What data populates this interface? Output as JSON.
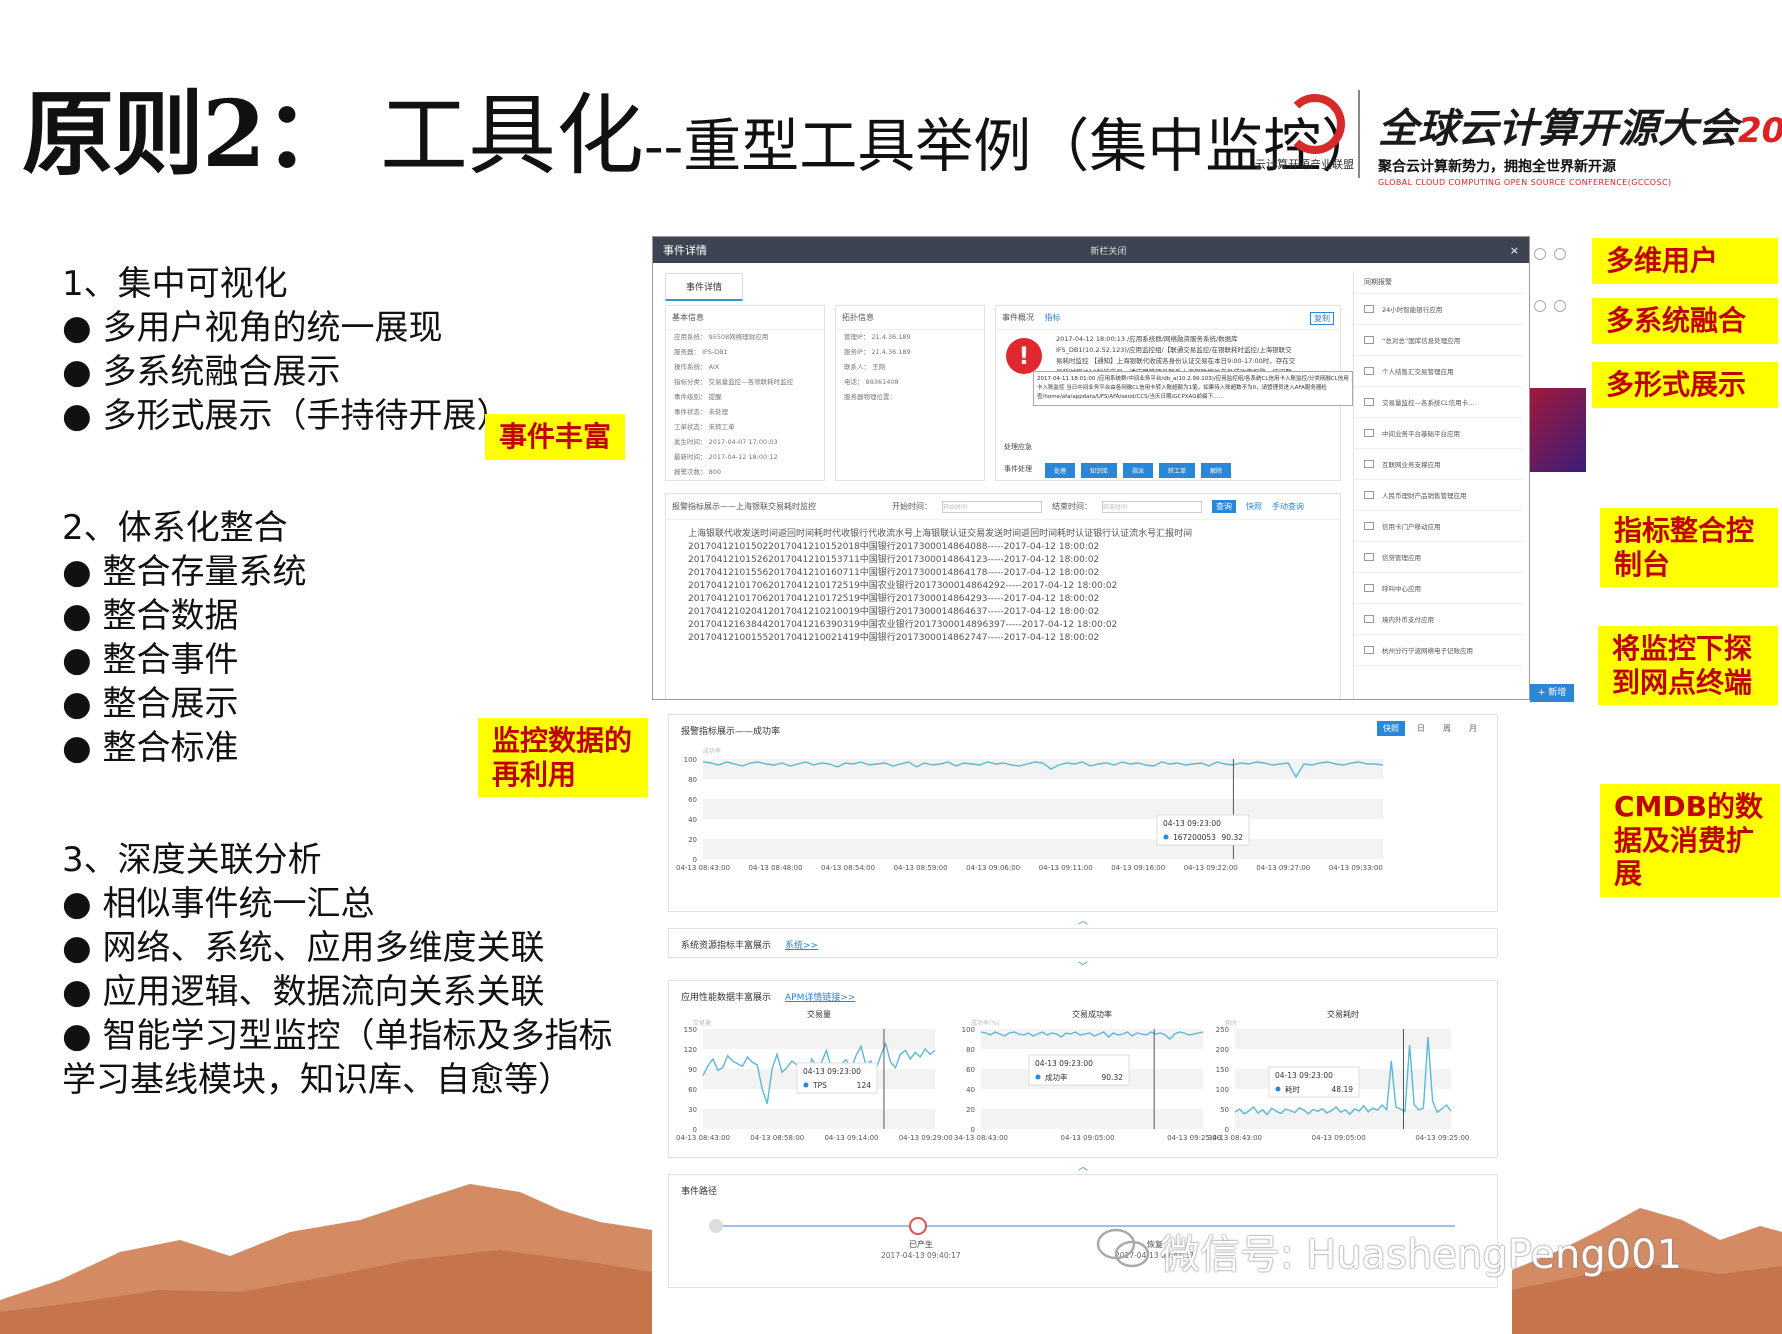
{
  "slide": {
    "title_main": "原则2：",
    "title_topic": "工具化",
    "title_sub": "--重型工具举例（集中监控）",
    "logo_text": "云计算开源产业联盟",
    "conference_name": "全球云计算开源大会",
    "conference_year": "2017",
    "conference_slogan": "聚合云计算新势力，拥抱全世界新开源",
    "conference_en": "GLOBAL CLOUD COMPUTING OPEN SOURCE CONFERENCE(GCCOSC)",
    "watermark": "微信号: HuashengPeng001"
  },
  "sections": [
    {
      "heading": "1、集中可视化",
      "items": [
        "● 多用户视角的统一展现",
        "● 多系统融合展示",
        "● 多形式展示（手持待开展）"
      ]
    },
    {
      "heading": "2、体系化整合",
      "items": [
        "● 整合存量系统",
        "● 整合数据",
        "● 整合事件",
        "● 整合展示",
        "● 整合标准"
      ]
    },
    {
      "heading": "3、深度关联分析",
      "items": [
        "● 相似事件统一汇总",
        "● 网络、系统、应用多维度关联",
        "● 应用逻辑、数据流向关系关联",
        "● 智能学习型监控（单指标及多指标",
        "学习基线模块，知识库、自愈等）"
      ]
    }
  ],
  "tags": {
    "events_rich": "事件丰富",
    "data_reuse": "监控数据的再利用",
    "multi_user": "多维用户",
    "multi_system": "多系统融合",
    "multi_form": "多形式展示",
    "indicator_console": "指标整合控制台",
    "drill_down": "将监控下探到网点终端",
    "cmdb": "CMDB的数据及消费扩展"
  },
  "event_window": {
    "title": "事件详情",
    "center": "新栏关闭",
    "close": "×",
    "tab": "事件详情",
    "basic_header": "基本信息",
    "topo_header": "拓扑信息",
    "summary_header": "事件概况",
    "summary_link": "指标",
    "copy_btn": "复制",
    "basic": [
      "应用系统：  95508网络理财应用",
      "服务器：   IFS-DB1",
      "操作系统：  AIX",
      "指标分类：  交易量监控—各领联耗时监控",
      "事件级别：  提醒",
      "事件状态：  未处理",
      "工单状态：  未转工单",
      "发生时间：  2017-04-07 17:00:03",
      "最新时间：  2017-04-12 18:00:12",
      "报警次数：  800"
    ],
    "topo": [
      "管理IP：     21.4.36.189",
      "服务IP：     21.4.36.189",
      "联系人：     王刚",
      "电话：       89361408",
      "服务器物理位置："
    ],
    "event_text": "2017-04-12 18:00:13 /应用系统群/网络融资服务系统/数据库IFS_DB1(10.2.52.123)/应用监控组/【联通交易监控/在银联耗时监控/上海银联交易耗时监控 【通知】上海银联代收成各身份认证交易在本日9:00-17:00时，存在交易耗时超过10秒的交易，请应用管理员联系上海银联相关交易成功率报警。该问题一般为银联问题，可提供本监控中的流水至上海银联查询。",
    "tooltip_text": "2017-04-11 18:01:00 /应用系统群/中间业务平台/db_a(10.2.99.103)/应用监控组/各系统CL信用卡入账监控/分类网融CL信用卡入账监控 当日中间业务平台由各网融CL信用卡转入账超额为1笔，如果待入账超数不为0，请管理员进入AFA服务器检查/home/afa/appdata/UFS/AFA/send/CCS/当天日期/GCPXAG前缀下……",
    "action_labels": [
      "处理应急",
      "事件处理"
    ],
    "buttons": [
      "处理",
      "知识库",
      "指派",
      "转工单",
      "解除"
    ],
    "table_title": "报警指标展示——上海银联交易耗时监控",
    "start_label": "开始时间：",
    "start_placeholder": "开始时间",
    "end_label": "结束时间：",
    "end_placeholder": "结束时间",
    "query_btn": "查询",
    "links": [
      "快照",
      "手动查询"
    ],
    "columns": [
      "上海银联代收发送时间",
      "返回时间",
      "耗时",
      "代收银行",
      "代收流水号",
      "上海银联认证交易发送时间",
      "返回时间",
      "耗时",
      "认证银行",
      "认证流水号",
      "汇报时间"
    ],
    "rows": [
      [
        "20170412101502",
        "20170412101520",
        "18",
        "中国银行",
        "2017300014864088",
        "-",
        "-",
        "-",
        "-",
        "-",
        "2017-04-12 18:00:02"
      ],
      [
        "20170412101526",
        "20170412101537",
        "11",
        "中国银行",
        "2017300014864123",
        "-",
        "-",
        "-",
        "-",
        "-",
        "2017-04-12 18:00:02"
      ],
      [
        "20170412101556",
        "20170412101607",
        "11",
        "中国银行",
        "2017300014864178",
        "-",
        "-",
        "-",
        "-",
        "-",
        "2017-04-12 18:00:02"
      ],
      [
        "20170412101706",
        "20170412101725",
        "19",
        "中国农业银行",
        "2017300014864292",
        "-",
        "-",
        "-",
        "-",
        "-",
        "2017-04-12 18:00:02"
      ],
      [
        "20170412101706",
        "20170412101725",
        "19",
        "中国银行",
        "2017300014864293",
        "-",
        "-",
        "-",
        "-",
        "-",
        "2017-04-12 18:00:02"
      ],
      [
        "20170412102041",
        "20170412102100",
        "19",
        "中国银行",
        "2017300014864637",
        "-",
        "-",
        "-",
        "-",
        "-",
        "2017-04-12 18:00:02"
      ],
      [
        "20170412163844",
        "20170412163903",
        "19",
        "中国农业银行",
        "2017300014896397",
        "-",
        "-",
        "-",
        "-",
        "-",
        "2017-04-12 18:00:02"
      ],
      [
        "20170412100155",
        "20170412100214",
        "19",
        "中国银行",
        "2017300014862747",
        "-",
        "-",
        "-",
        "-",
        "-",
        "2017-04-12 18:00:02"
      ]
    ],
    "side_header": "同期报警",
    "side_items": [
      "24小时智能银行应用",
      "“总对总”国库信息处理应用",
      "个人结售汇交易管理应用",
      "交易量监控—各系统CL信用卡…",
      "中间业务平台基础平台应用",
      "互联网业务支撑应用",
      "人民币理财产品销售管理应用",
      "信用卡门户移动应用",
      "信贷管理应用",
      "呼叫中心应用",
      "境内外币支付应用",
      "杭州分行宁波网络电子记账应用"
    ]
  },
  "right_edge": {
    "new_button": "+ 新增"
  },
  "success_panel": {
    "title": "报警指标展示——成功率",
    "buttons": [
      "快照",
      "日",
      "周",
      "月"
    ],
    "tooltip_time": "04-13 09:23:00",
    "tooltip_series": "167200053",
    "tooltip_value": "90.32",
    "y_label": "成功率"
  },
  "sysres_panel": {
    "title": "系统资源指标丰富展示",
    "link": "系统>>"
  },
  "apm_panel": {
    "title": "应用性能数据丰富展示",
    "link": "APM详情链接>>",
    "charts": [
      {
        "title": "交易量",
        "ylabel": "交易量",
        "tip_time": "04-13 09:23:00",
        "tip_name": "TPS",
        "tip_value": "124"
      },
      {
        "title": "交易成功率",
        "ylabel": "成功率(%)",
        "tip_time": "04-13 09:23:00",
        "tip_name": "成功率",
        "tip_value": "90.32"
      },
      {
        "title": "交易耗时",
        "ylabel": "耗时",
        "tip_time": "04-13 09:23:00",
        "tip_name": "耗时",
        "tip_value": "48.19"
      }
    ]
  },
  "path_panel": {
    "title": "事件路径",
    "steps": [
      {
        "label": "已产生",
        "time": "2017-04-13 09:40:17"
      },
      {
        "label": "恢复",
        "time": "2017-04-13 09:41:31"
      }
    ]
  },
  "chart_data": [
    {
      "type": "line",
      "title": "报警指标展示——成功率",
      "ylabel": "成功率",
      "ylim": [
        0,
        100
      ],
      "yticks": [
        0,
        20,
        40,
        60,
        80,
        100
      ],
      "xticks": [
        "04-13 08:43:00",
        "04-13 08:48:00",
        "04-13 08:54:00",
        "04-13 08:59:00",
        "04-13 09:06:00",
        "04-13 09:11:00",
        "04-13 09:16:00",
        "04-13 09:22:00",
        "04-13 09:27:00",
        "04-13 09:33:00"
      ],
      "series": [
        {
          "name": "167200053",
          "values": [
            97,
            96,
            94,
            97,
            95,
            93,
            96,
            97,
            95,
            94,
            96,
            93,
            95,
            97,
            94,
            96,
            95,
            92,
            96,
            95,
            97,
            94,
            95,
            96,
            93,
            95,
            97,
            92,
            96,
            94,
            95,
            97,
            93,
            96,
            95,
            94,
            97,
            95,
            96,
            94,
            93,
            95,
            97,
            96,
            90,
            94,
            96,
            95,
            97,
            93,
            95,
            96,
            94,
            97,
            95,
            96,
            94,
            93,
            97,
            95,
            96,
            94,
            95,
            96,
            93,
            97,
            95,
            94,
            96,
            95,
            97,
            96,
            94,
            95,
            96,
            82,
            95,
            94,
            96,
            97,
            95,
            94,
            96,
            97,
            95,
            95,
            94
          ]
        }
      ],
      "marker_x": "04-13 09:23:00",
      "grid": true
    },
    {
      "type": "line",
      "title": "交易量",
      "ylim": [
        0,
        150
      ],
      "yticks": [
        0,
        30,
        60,
        90,
        120,
        150
      ],
      "xticks": [
        "04-13 08:43:00",
        "04-13 08:58:00",
        "04-13 09:14:00",
        "04-13 09:29:00"
      ],
      "series": [
        {
          "name": "TPS",
          "values": [
            80,
            95,
            105,
            88,
            92,
            110,
            102,
            98,
            94,
            108,
            100,
            96,
            60,
            38,
            90,
            112,
            85,
            92,
            102,
            96,
            88,
            70,
            105,
            95,
            100,
            118,
            92,
            86,
            98,
            104,
            90,
            110,
            124,
            96,
            102,
            88,
            110,
            128,
            100,
            92,
            112,
            118,
            105,
            115,
            108,
            120,
            112,
            118
          ]
        }
      ],
      "marker_x": "04-13 09:23:00",
      "grid": true
    },
    {
      "type": "line",
      "title": "交易成功率",
      "ylim": [
        0,
        100
      ],
      "yticks": [
        0,
        20,
        40,
        60,
        80,
        100
      ],
      "xticks": [
        "34-13 08:43:00",
        "04-13 09:05:00",
        "04-13 09:25:00"
      ],
      "series": [
        {
          "name": "成功率",
          "values": [
            97,
            96,
            94,
            97,
            95,
            93,
            96,
            97,
            95,
            94,
            96,
            93,
            95,
            97,
            94,
            96,
            95,
            92,
            96,
            95,
            97,
            94,
            95,
            96,
            93,
            95,
            97,
            92,
            96,
            94,
            95,
            97,
            93,
            96,
            95,
            94,
            97,
            95,
            96,
            94,
            90,
            95,
            97,
            96,
            94,
            95,
            96,
            97
          ]
        }
      ],
      "marker_x": "04-13 09:23:00",
      "grid": true
    },
    {
      "type": "line",
      "title": "交易耗时",
      "ylim": [
        0,
        250
      ],
      "yticks": [
        0,
        50,
        100,
        150,
        200,
        250
      ],
      "xticks": [
        "34-13 08:43:00",
        "04-13 09:05:00",
        "04-13 09:25:00"
      ],
      "series": [
        {
          "name": "耗时",
          "values": [
            42,
            50,
            38,
            45,
            55,
            40,
            48,
            36,
            52,
            44,
            39,
            50,
            46,
            41,
            53,
            47,
            38,
            49,
            44,
            51,
            40,
            46,
            55,
            42,
            48,
            37,
            50,
            45,
            58,
            43,
            52,
            47,
            60,
            48,
            170,
            55,
            50,
            44,
            210,
            60,
            48,
            52,
            230,
            70,
            42,
            50,
            60,
            45
          ]
        }
      ],
      "marker_x": "04-13 09:23:00",
      "grid": true
    }
  ]
}
